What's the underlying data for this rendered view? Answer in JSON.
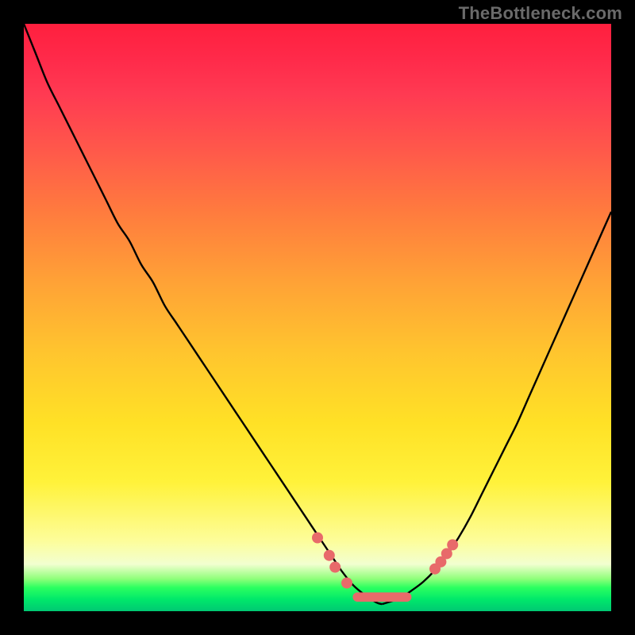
{
  "watermark": "TheBottleneck.com",
  "chart_data": {
    "type": "line",
    "title": "",
    "xlabel": "",
    "ylabel": "",
    "xlim": [
      0,
      100
    ],
    "ylim": [
      0,
      100
    ],
    "grid": false,
    "legend": false,
    "series": [
      {
        "name": "left_curve",
        "x": [
          0,
          2,
          4,
          6,
          8,
          10,
          12,
          14,
          16,
          18,
          20,
          22,
          24,
          26,
          28,
          30,
          32,
          34,
          36,
          38,
          40,
          42,
          44,
          46,
          48,
          50,
          52,
          53,
          54,
          56,
          58,
          60,
          61
        ],
        "values": [
          100,
          95,
          90,
          86,
          82,
          78,
          74,
          70,
          66,
          63,
          59,
          56,
          52,
          49,
          46,
          43,
          40,
          37,
          34,
          31,
          28,
          25,
          22,
          19,
          16,
          13,
          10,
          8.5,
          7,
          4.5,
          2.8,
          1.5,
          1.2
        ]
      },
      {
        "name": "right_curve",
        "x": [
          61,
          62,
          64,
          66,
          68,
          70,
          72,
          74,
          76,
          78,
          80,
          82,
          84,
          86,
          88,
          90,
          92,
          94,
          96,
          98,
          100
        ],
        "values": [
          1.2,
          1.5,
          2.2,
          3.5,
          5,
          7,
          9.5,
          12.5,
          16,
          20,
          24,
          28,
          32,
          36.5,
          41,
          45.5,
          50,
          54.5,
          59,
          63.5,
          68
        ]
      }
    ],
    "markers": [
      {
        "x": 50,
        "y": 12.5
      },
      {
        "x": 52,
        "y": 9.5
      },
      {
        "x": 53,
        "y": 7.5
      },
      {
        "x": 55,
        "y": 4.8
      },
      {
        "x": 70,
        "y": 7.2
      },
      {
        "x": 71,
        "y": 8.4
      },
      {
        "x": 72,
        "y": 9.8
      },
      {
        "x": 73,
        "y": 11.3
      }
    ],
    "highlight_segment": {
      "x0": 56,
      "x1": 66,
      "y": 2.4,
      "thickness": 1.6
    }
  }
}
